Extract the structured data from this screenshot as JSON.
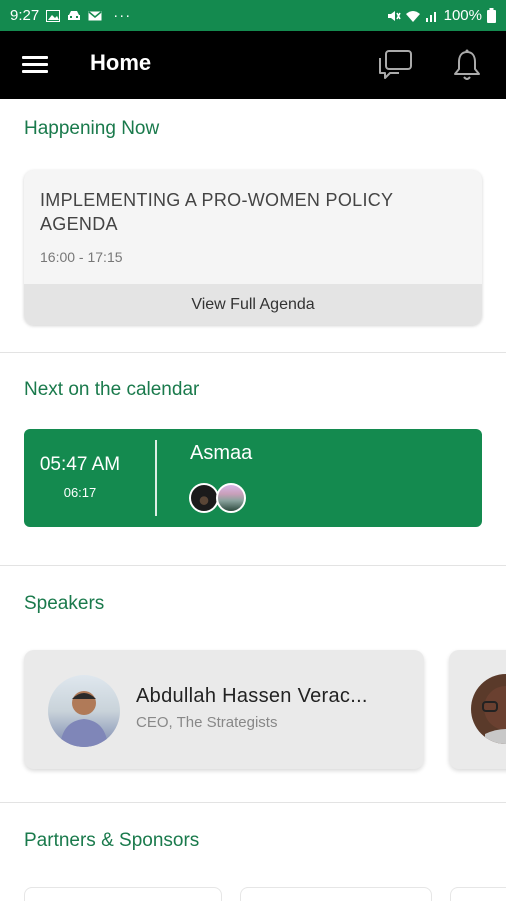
{
  "status_bar": {
    "time": "9:27",
    "more": "···",
    "battery": "100%",
    "icons": [
      "image-icon",
      "car-icon",
      "mail-icon",
      "mute-icon",
      "wifi-icon",
      "signal-icon",
      "battery-icon"
    ]
  },
  "app_bar": {
    "title": "Home",
    "menu_icon": "menu-icon",
    "chat_icon": "chat-icon",
    "bell_icon": "bell-icon"
  },
  "happening_now": {
    "heading": "Happening Now",
    "session_title": "IMPLEMENTING A PRO-WOMEN POLICY AGENDA",
    "session_time": "16:00 - 17:15",
    "button_label": "View Full Agenda"
  },
  "next_calendar": {
    "heading": "Next on the calendar",
    "time": "05:47 AM",
    "duration": "06:17",
    "name": "Asmaa"
  },
  "speakers": {
    "heading": "Speakers",
    "items": [
      {
        "name": "Abdullah Hassen Verac...",
        "role": "CEO, The Strategists"
      }
    ]
  },
  "partners": {
    "heading": "Partners & Sponsors"
  },
  "colors": {
    "brand_green": "#148a4f",
    "heading_green": "#1a7a4c",
    "app_bar": "#000000"
  }
}
